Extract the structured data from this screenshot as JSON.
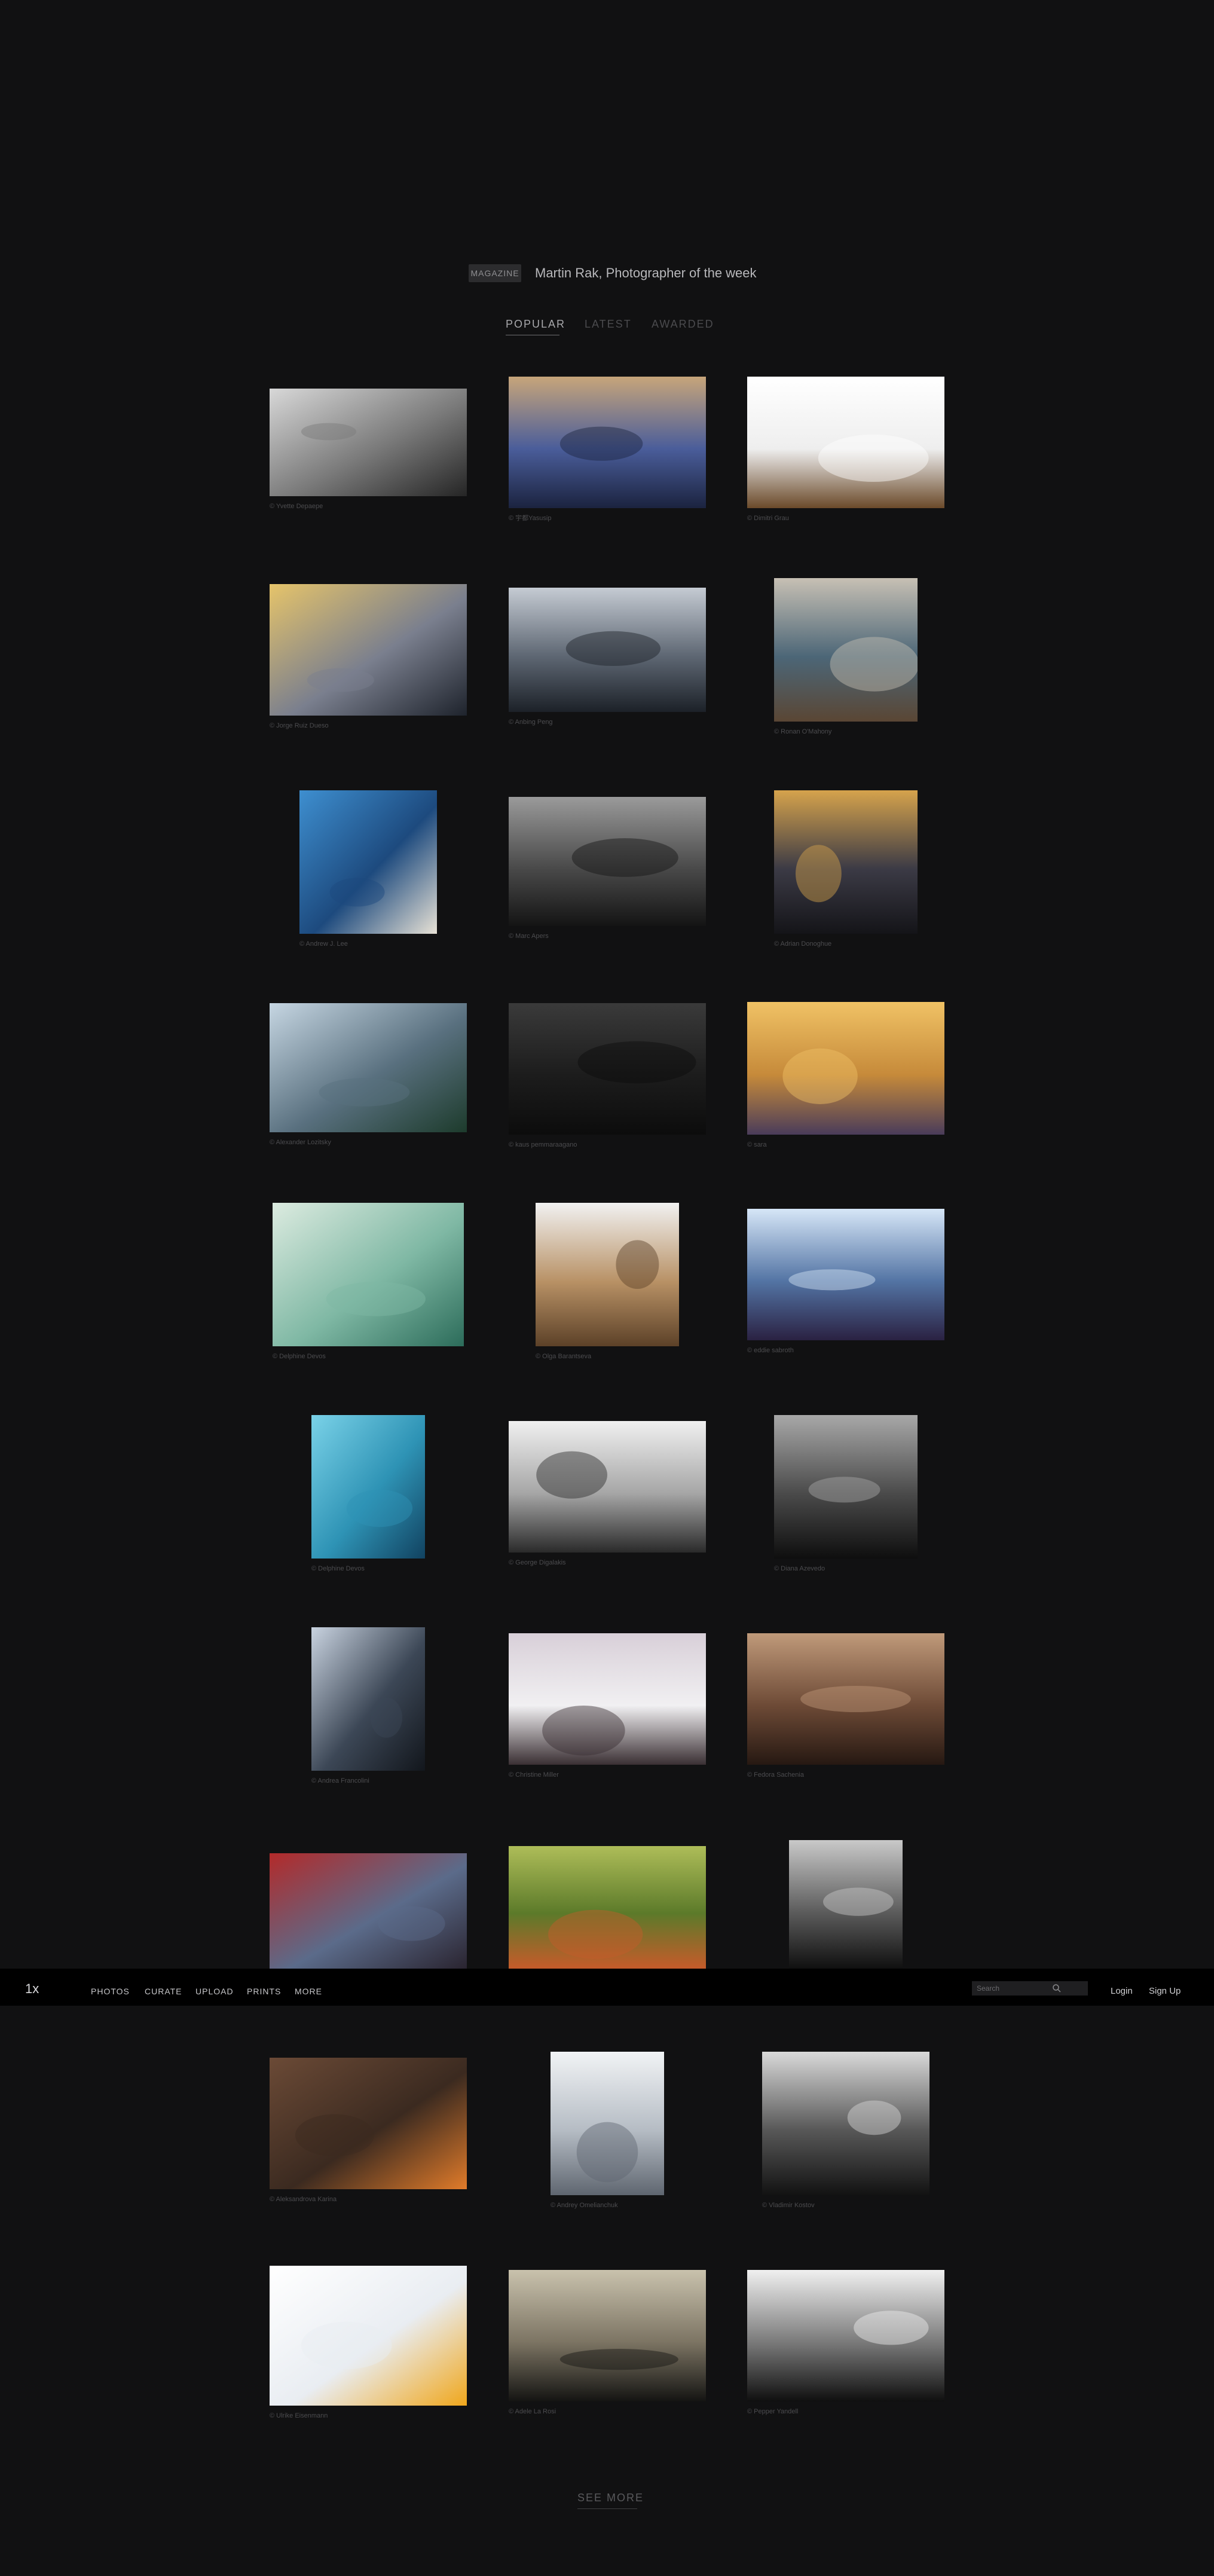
{
  "magazine": {
    "badge": "MAGAZINE",
    "title": "Martin Rak, Photographer of the week"
  },
  "tabs": [
    {
      "label": "POPULAR",
      "active": true
    },
    {
      "label": "LATEST",
      "active": false
    },
    {
      "label": "AWARDED",
      "active": false
    }
  ],
  "photos": [
    {
      "credit": "© Yvette Depaepe",
      "palette": [
        "#d8d8d8",
        "#7a7a7a",
        "#252525"
      ]
    },
    {
      "credit": "© 宇都Yasusip",
      "palette": [
        "#c7a57a",
        "#4a5d9a",
        "#1b233f"
      ]
    },
    {
      "credit": "© Dimitri Grau",
      "palette": [
        "#ffffff",
        "#eeeeee",
        "#6b4a2a"
      ]
    },
    {
      "credit": "© Jorge Ruiz Dueso",
      "palette": [
        "#e6c46a",
        "#7a7f8e",
        "#1e232c"
      ]
    },
    {
      "credit": "© Anbing Peng",
      "palette": [
        "#c5cbd3",
        "#5e6773",
        "#1c2128"
      ]
    },
    {
      "credit": "© Ronan O'Mahony",
      "palette": [
        "#c7c0b4",
        "#4c6677",
        "#5a4634"
      ]
    },
    {
      "credit": "© Andrew J. Lee",
      "palette": [
        "#3e8fd0",
        "#1d4a7e",
        "#e8e2d6"
      ]
    },
    {
      "credit": "© Marc Apers",
      "palette": [
        "#9a9a9a",
        "#4a4a4a",
        "#141414"
      ]
    },
    {
      "credit": "© Adrian Donoghue",
      "palette": [
        "#d6a34c",
        "#3b3a45",
        "#141418"
      ]
    },
    {
      "credit": "© Alexander Lozitsky",
      "palette": [
        "#c6d6e2",
        "#59707f",
        "#1d3b2c"
      ]
    },
    {
      "credit": "© kaus pemmaraagano",
      "palette": [
        "#3a3a3a",
        "#1c1c1c",
        "#0c0c0c"
      ]
    },
    {
      "credit": "© sara",
      "palette": [
        "#f0c265",
        "#c68a3a",
        "#4a3c5a"
      ]
    },
    {
      "credit": "© Delphine Devos",
      "palette": [
        "#dcebe0",
        "#7fb8a4",
        "#2c6c5a"
      ]
    },
    {
      "credit": "© Olga Barantseva",
      "palette": [
        "#f1f1f1",
        "#b89165",
        "#5c4128"
      ]
    },
    {
      "credit": "© eddie sabroth",
      "palette": [
        "#d6e6f7",
        "#5374a4",
        "#2a2142"
      ]
    },
    {
      "credit": "© Delphine Devos",
      "palette": [
        "#7ad2e8",
        "#2e93b5",
        "#114260"
      ]
    },
    {
      "credit": "© George Digalakis",
      "palette": [
        "#f0f0f0",
        "#a6a6a6",
        "#2a2a2a"
      ]
    },
    {
      "credit": "© Diana Azevedo",
      "palette": [
        "#a8a8a8",
        "#4a4a4a",
        "#0e0e0e"
      ]
    },
    {
      "credit": "© Andrea Francolini",
      "palette": [
        "#c9d3e0",
        "#3c4756",
        "#12161c"
      ]
    },
    {
      "credit": "© Christine Miller",
      "palette": [
        "#d8cfd8",
        "#f1f0f2",
        "#3a2f33"
      ]
    },
    {
      "credit": "© Fedora Sachenia",
      "palette": [
        "#c09a7a",
        "#6d4a36",
        "#261812"
      ]
    },
    {
      "credit": "",
      "palette": [
        "#b32a2a",
        "#5b6b8a",
        "#2a2430"
      ]
    },
    {
      "credit": "",
      "palette": [
        "#aebd58",
        "#5c7a2a",
        "#c65b2a"
      ]
    },
    {
      "credit": "",
      "palette": [
        "#c9c9c9",
        "#5e5e5e",
        "#101010"
      ]
    },
    {
      "credit": "© Aleksandrova Karina",
      "palette": [
        "#6b4a36",
        "#3b2a20",
        "#e07b2a"
      ]
    },
    {
      "credit": "© Andrey Omelianchuk",
      "palette": [
        "#f1f3f5",
        "#b5bcc4",
        "#5f6670"
      ]
    },
    {
      "credit": "© Vladimir Kostov",
      "palette": [
        "#d9d9d9",
        "#575757",
        "#121212"
      ]
    },
    {
      "credit": "© Ulrike Eisenmann",
      "palette": [
        "#ffffff",
        "#e9edf2",
        "#f0a71c"
      ]
    },
    {
      "credit": "© Adele La Rosi",
      "palette": [
        "#c9c2ad",
        "#7c7463",
        "#141412"
      ]
    },
    {
      "credit": "© Pepper Yandell",
      "palette": [
        "#f0f0f0",
        "#7a7a7a",
        "#0f0f0f"
      ]
    }
  ],
  "nav": {
    "logo_text": "1x",
    "items": [
      "PHOTOS",
      "CURATE",
      "UPLOAD",
      "PRINTS",
      "MORE"
    ],
    "search_placeholder": "Search",
    "login": "Login",
    "signup": "Sign Up"
  },
  "footer": {
    "see_more": "SEE MORE"
  },
  "icons": {
    "search": "search-icon",
    "logo": "logo-mark"
  }
}
